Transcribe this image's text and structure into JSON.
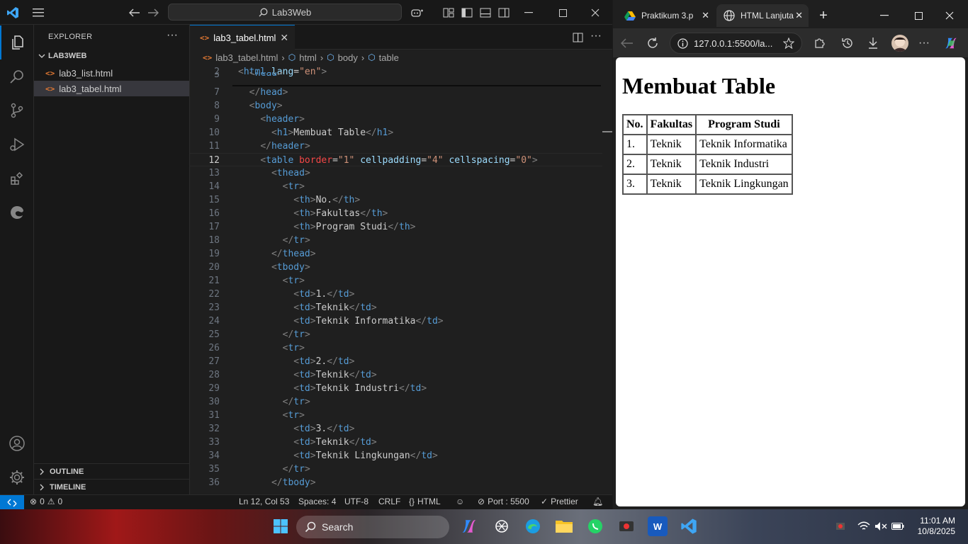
{
  "vscode": {
    "title_search": "Lab3Web",
    "explorer_heading": "EXPLORER",
    "folder": "LAB3WEB",
    "files": [
      "lab3_list.html",
      "lab3_tabel.html"
    ],
    "selected_file": "lab3_tabel.html",
    "sections": [
      "OUTLINE",
      "TIMELINE"
    ],
    "tab_label": "lab3_tabel.html",
    "breadcrumb": [
      "lab3_tabel.html",
      "html",
      "body",
      "table"
    ],
    "line_numbers": [
      "2",
      "3",
      "7",
      "8",
      "9",
      "10",
      "11",
      "12",
      "13",
      "14",
      "15",
      "16",
      "17",
      "18",
      "19",
      "20",
      "21",
      "22",
      "23",
      "24",
      "25",
      "26",
      "27",
      "28",
      "29",
      "30",
      "31",
      "32",
      "33",
      "34",
      "35",
      "36"
    ],
    "current_line": "12",
    "statusbar": {
      "problems": "0",
      "warnings": "0",
      "position": "Ln 12, Col 53",
      "spaces": "Spaces: 4",
      "encoding": "UTF-8",
      "eol": "CRLF",
      "language": "HTML",
      "port": "Port : 5500",
      "formatter": "Prettier"
    }
  },
  "edge": {
    "tabs": [
      "Praktikum 3.p",
      "HTML Lanjuta"
    ],
    "address": "127.0.0.1:5500/la...",
    "page": {
      "heading": "Membuat Table",
      "table_headers": [
        "No.",
        "Fakultas",
        "Program Studi"
      ],
      "table_rows": [
        [
          "1.",
          "Teknik",
          "Teknik Informatika"
        ],
        [
          "2.",
          "Teknik",
          "Teknik Industri"
        ],
        [
          "3.",
          "Teknik",
          "Teknik Lingkungan"
        ]
      ]
    }
  },
  "taskbar": {
    "search_placeholder": "Search",
    "time": "11:01 AM",
    "date": "10/8/2025"
  },
  "colors": {
    "vscode_bg": "#1f1f1f",
    "accent": "#0078d4",
    "tag": "#569cd6",
    "attr": "#9cdcfe",
    "value": "#ce9178"
  }
}
